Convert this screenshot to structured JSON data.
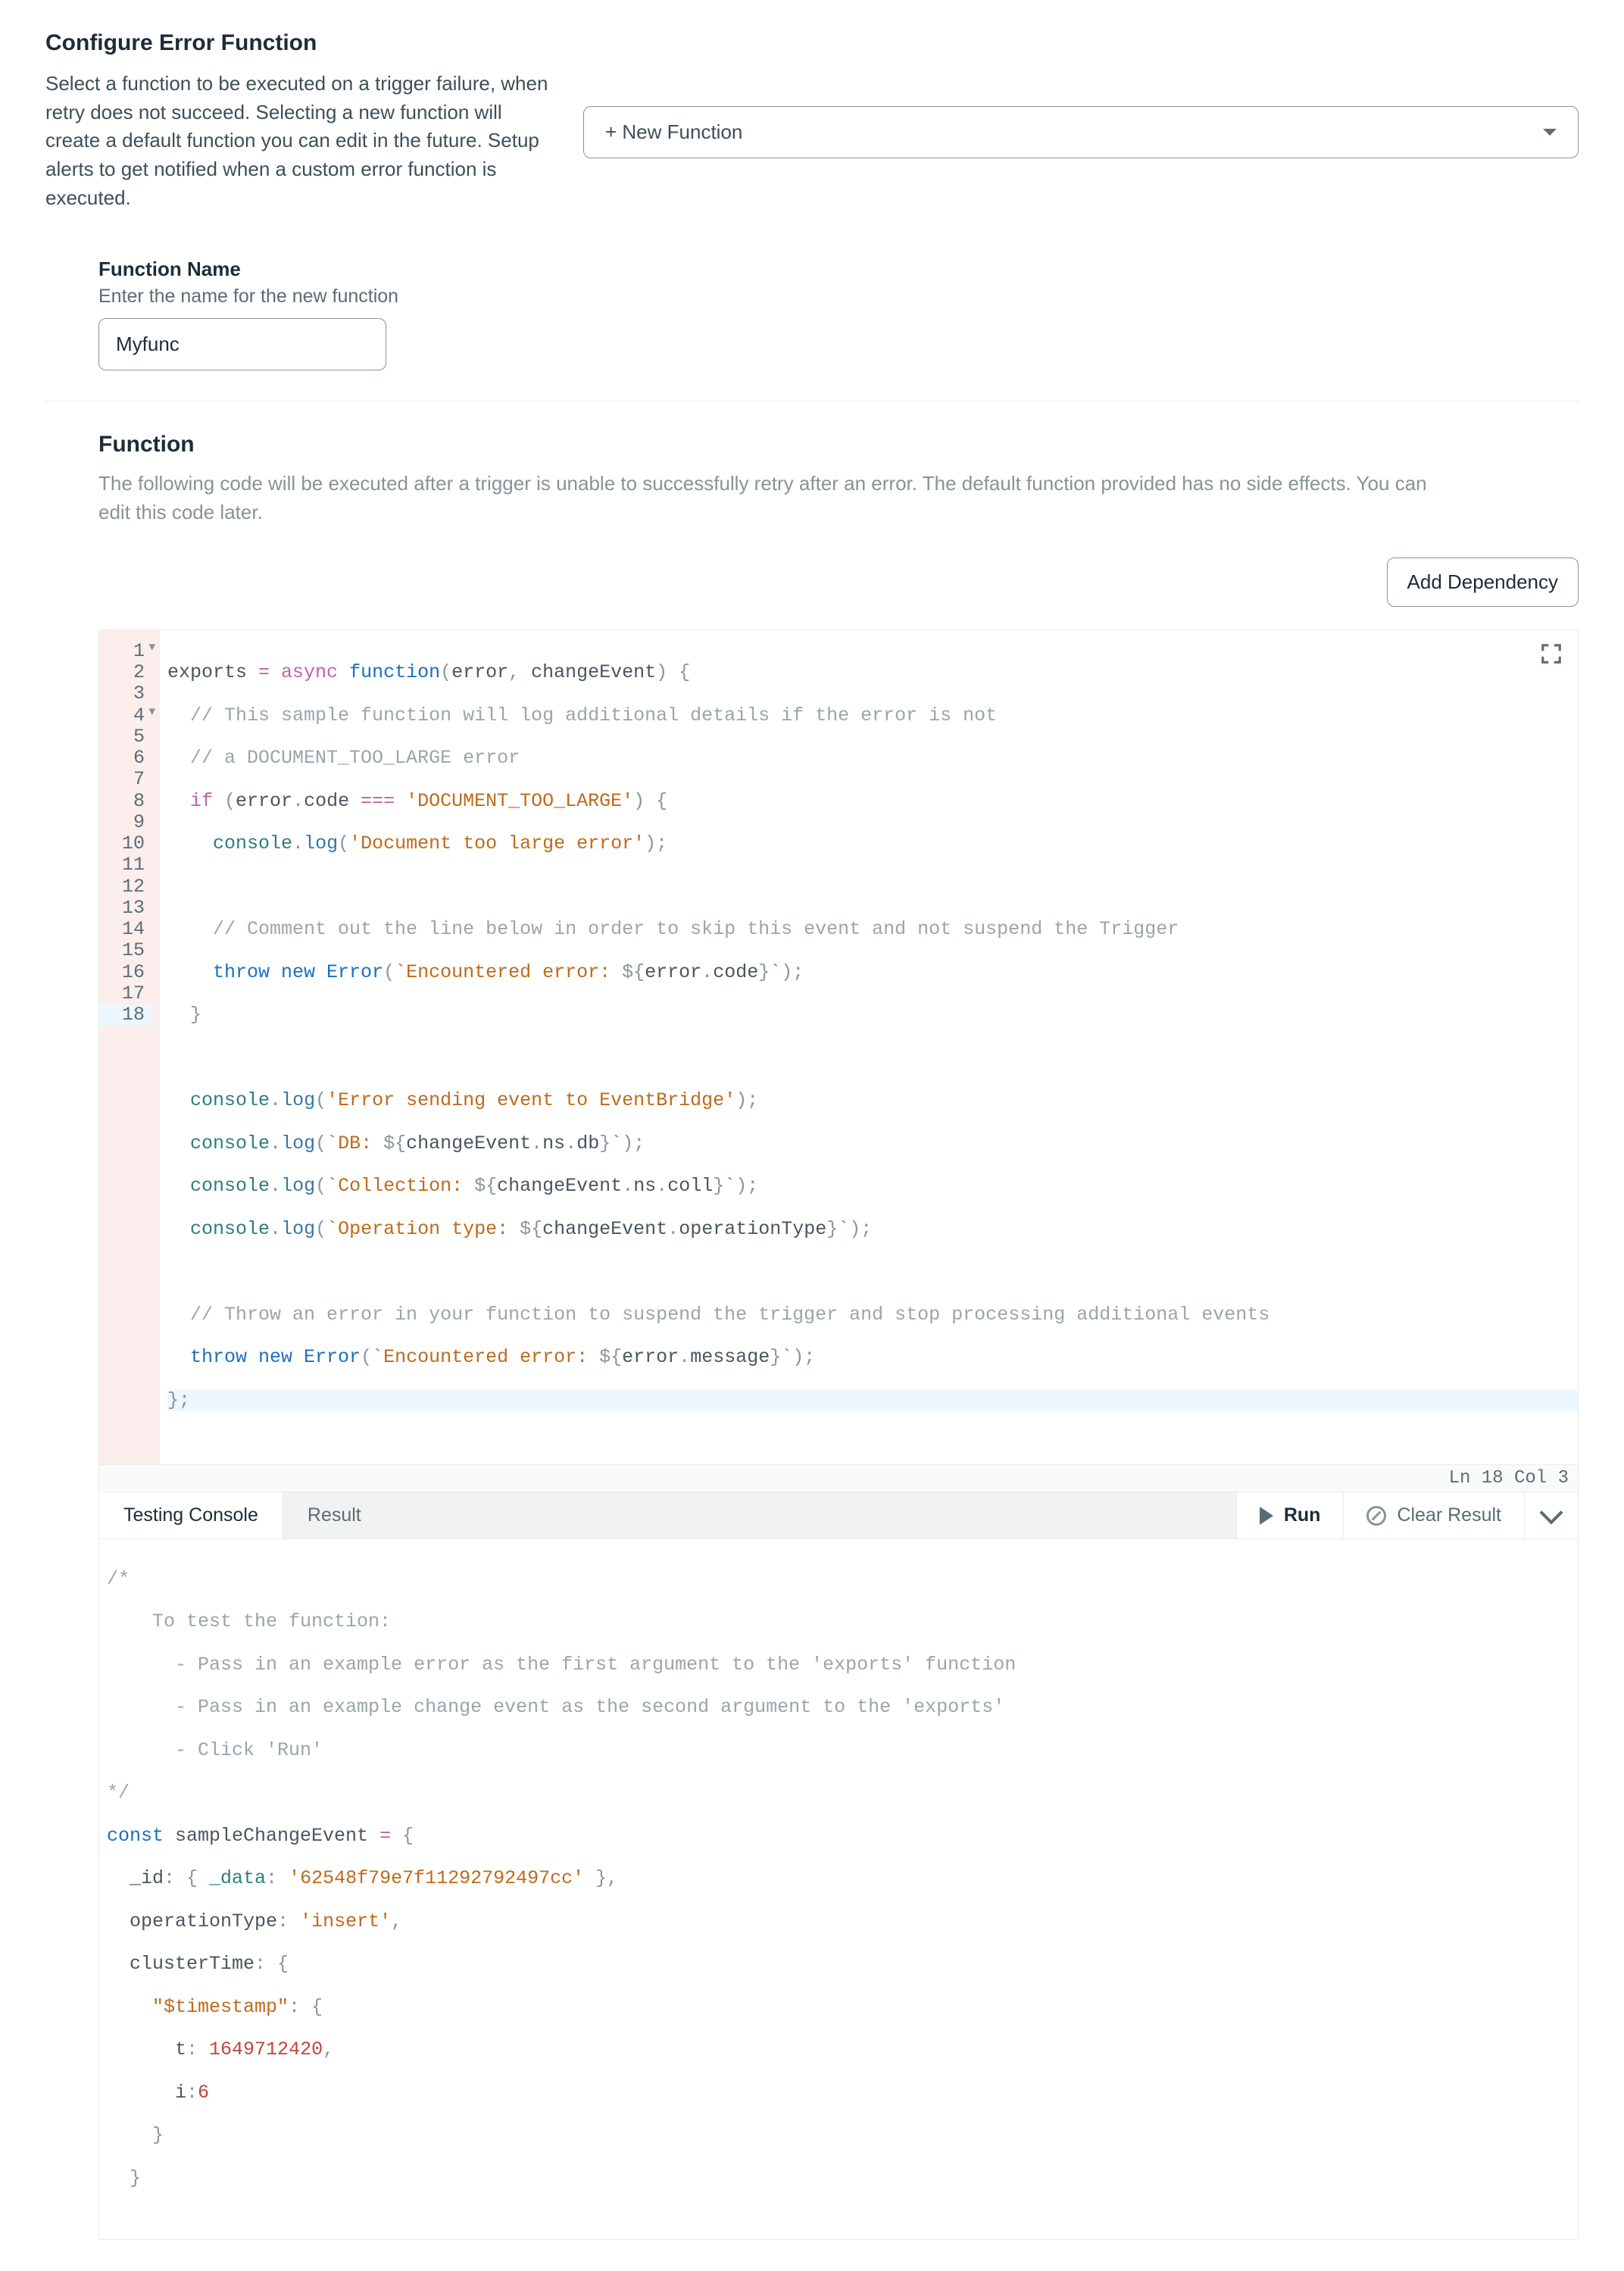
{
  "header": {
    "title": "Configure Error Function",
    "description": "Select a function to be executed on a trigger failure, when retry does not succeed. Selecting a new function will create a default function you can edit in the future. Setup alerts to get notified when a custom error function is executed."
  },
  "dropdown": {
    "selected": "+ New Function"
  },
  "functionName": {
    "label": "Function Name",
    "sublabel": "Enter the name for the new function",
    "value": "Myfunc"
  },
  "functionSection": {
    "title": "Function",
    "description": "The following code will be executed after a trigger is unable to successfully retry after an error. The default function provided has no side effects. You can edit this code later.",
    "addDependency": "Add Dependency"
  },
  "editor": {
    "lines": [
      1,
      2,
      3,
      4,
      5,
      6,
      7,
      8,
      9,
      10,
      11,
      12,
      13,
      14,
      15,
      16,
      17,
      18
    ],
    "folds": [
      1,
      4
    ],
    "status": "Ln 18 Col 3",
    "code": {
      "l1": {
        "a": "exports ",
        "b": "= ",
        "c": "async ",
        "d": "function",
        "e": "(",
        "f": "error",
        "g": ", ",
        "h": "changeEvent",
        "i": ") {"
      },
      "l2": "// This sample function will log additional details if the error is not",
      "l3": "// a DOCUMENT_TOO_LARGE error",
      "l4": {
        "a": "if ",
        "b": "(",
        "c": "error",
        "d": ".",
        "e": "code ",
        "f": "=== ",
        "g": "'DOCUMENT_TOO_LARGE'",
        "h": ") {"
      },
      "l5": {
        "a": "console",
        "b": ".",
        "c": "log",
        "d": "(",
        "e": "'Document too large error'",
        "f": ");"
      },
      "l7": "// Comment out the line below in order to skip this event and not suspend the Trigger",
      "l8": {
        "a": "throw ",
        "b": "new ",
        "c": "Error",
        "d": "(",
        "e": "`Encountered error: ",
        "f": "${",
        "g": "error",
        "h": ".",
        "i": "code",
        "j": "}",
        "k": "`",
        "l": ");"
      },
      "l9": "}",
      "l11": {
        "a": "console",
        "b": ".",
        "c": "log",
        "d": "(",
        "e": "'Error sending event to EventBridge'",
        "f": ");"
      },
      "l12": {
        "a": "console",
        "b": ".",
        "c": "log",
        "d": "(",
        "e": "`DB: ",
        "f": "${",
        "g": "changeEvent",
        "h": ".",
        "i": "ns",
        "j": ".",
        "k": "db",
        "l": "}",
        "m": "`",
        "n": ");"
      },
      "l13": {
        "a": "console",
        "b": ".",
        "c": "log",
        "d": "(",
        "e": "`Collection: ",
        "f": "${",
        "g": "changeEvent",
        "h": ".",
        "i": "ns",
        "j": ".",
        "k": "coll",
        "l": "}",
        "m": "`",
        "n": ");"
      },
      "l14": {
        "a": "console",
        "b": ".",
        "c": "log",
        "d": "(",
        "e": "`Operation type: ",
        "f": "${",
        "g": "changeEvent",
        "h": ".",
        "i": "operationType",
        "j": "}",
        "k": "`",
        "l": ");"
      },
      "l16": "// Throw an error in your function to suspend the trigger and stop processing additional events",
      "l17": {
        "a": "throw ",
        "b": "new ",
        "c": "Error",
        "d": "(",
        "e": "`Encountered error: ",
        "f": "${",
        "g": "error",
        "h": ".",
        "i": "message",
        "j": "}",
        "k": "`",
        "l": ");"
      },
      "l18": "};"
    }
  },
  "console": {
    "tabs": {
      "testing": "Testing Console",
      "result": "Result"
    },
    "run": "Run",
    "clear": "Clear Result"
  },
  "testCode": {
    "l1": "/*",
    "l2": "    To test the function:",
    "l3": "      - Pass in an example error as the first argument to the 'exports' function",
    "l4": "      - Pass in an example change event as the second argument to the 'exports'",
    "l5": "      - Click 'Run'",
    "l6": "*/",
    "l7": {
      "a": "const",
      "b": " sampleChangeEvent ",
      "c": "=",
      "d": " {"
    },
    "l8": {
      "a": "  _id",
      "b": ": { ",
      "c": "_data",
      "d": ": ",
      "e": "'62548f79e7f11292792497cc'",
      "f": " },"
    },
    "l9": {
      "a": "  operationType",
      "b": ": ",
      "c": "'insert'",
      "d": ","
    },
    "l10": {
      "a": "  clusterTime",
      "b": ": {"
    },
    "l11": {
      "a": "    ",
      "b": "\"$timestamp\"",
      "c": ": {"
    },
    "l12": {
      "a": "      t",
      "b": ": ",
      "c": "1649712420",
      "d": ","
    },
    "l13": {
      "a": "      i",
      "b": ":",
      "c": "6"
    },
    "l14": "    }",
    "l15": "  }"
  }
}
